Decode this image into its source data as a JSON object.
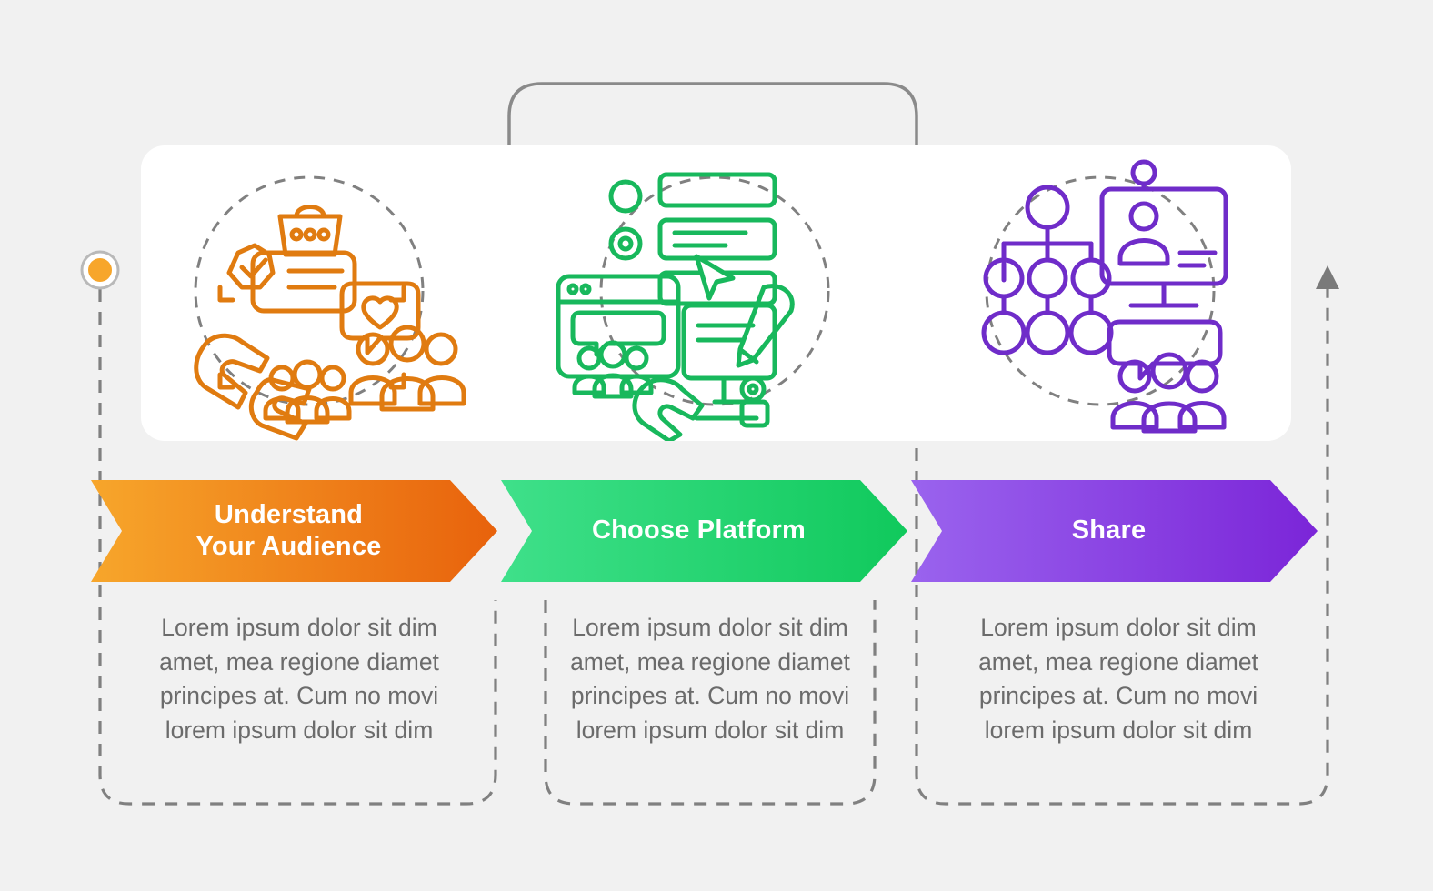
{
  "diagram": {
    "type": "3-step horizontal process infographic",
    "background_color": "#f1f1f1",
    "card_color": "#ffffff"
  },
  "steps": [
    {
      "id": "step-1",
      "title": "Understand\nYour Audience",
      "title_line1": "Understand",
      "title_line2": "Your Audience",
      "description": "Lorem ipsum dolor sit dim amet, mea regione diamet principes at. Cum no movi lorem ipsum dolor sit dim",
      "color_start": "#f7a62b",
      "color_end": "#e8620c",
      "marker_color": "#f7a62b",
      "icon_name": "audience-icon"
    },
    {
      "id": "step-2",
      "title": "Choose Platform",
      "title_line1": "Choose Platform",
      "title_line2": "",
      "description": "Lorem ipsum dolor sit dim amet, mea regione diamet principes at. Cum no movi lorem ipsum dolor sit dim",
      "color_start": "#3fe08a",
      "color_end": "#10c95c",
      "marker_color": "#16c464",
      "icon_name": "platform-editing-icon"
    },
    {
      "id": "step-3",
      "title": "Share",
      "title_line1": "Share",
      "title_line2": "",
      "description": "Lorem ipsum dolor sit dim amet, mea regione diamet principes at. Cum no movi lorem ipsum dolor sit dim",
      "color_start": "#9a63ee",
      "color_end": "#7b25d8",
      "marker_color": "#8b3fe0",
      "icon_name": "share-network-icon"
    }
  ],
  "connectors": {
    "dashed_color": "#808080",
    "solid_color": "#7a7a7a",
    "arrow_color": "#7a7a7a",
    "arrow_name": "end-arrow-icon"
  }
}
